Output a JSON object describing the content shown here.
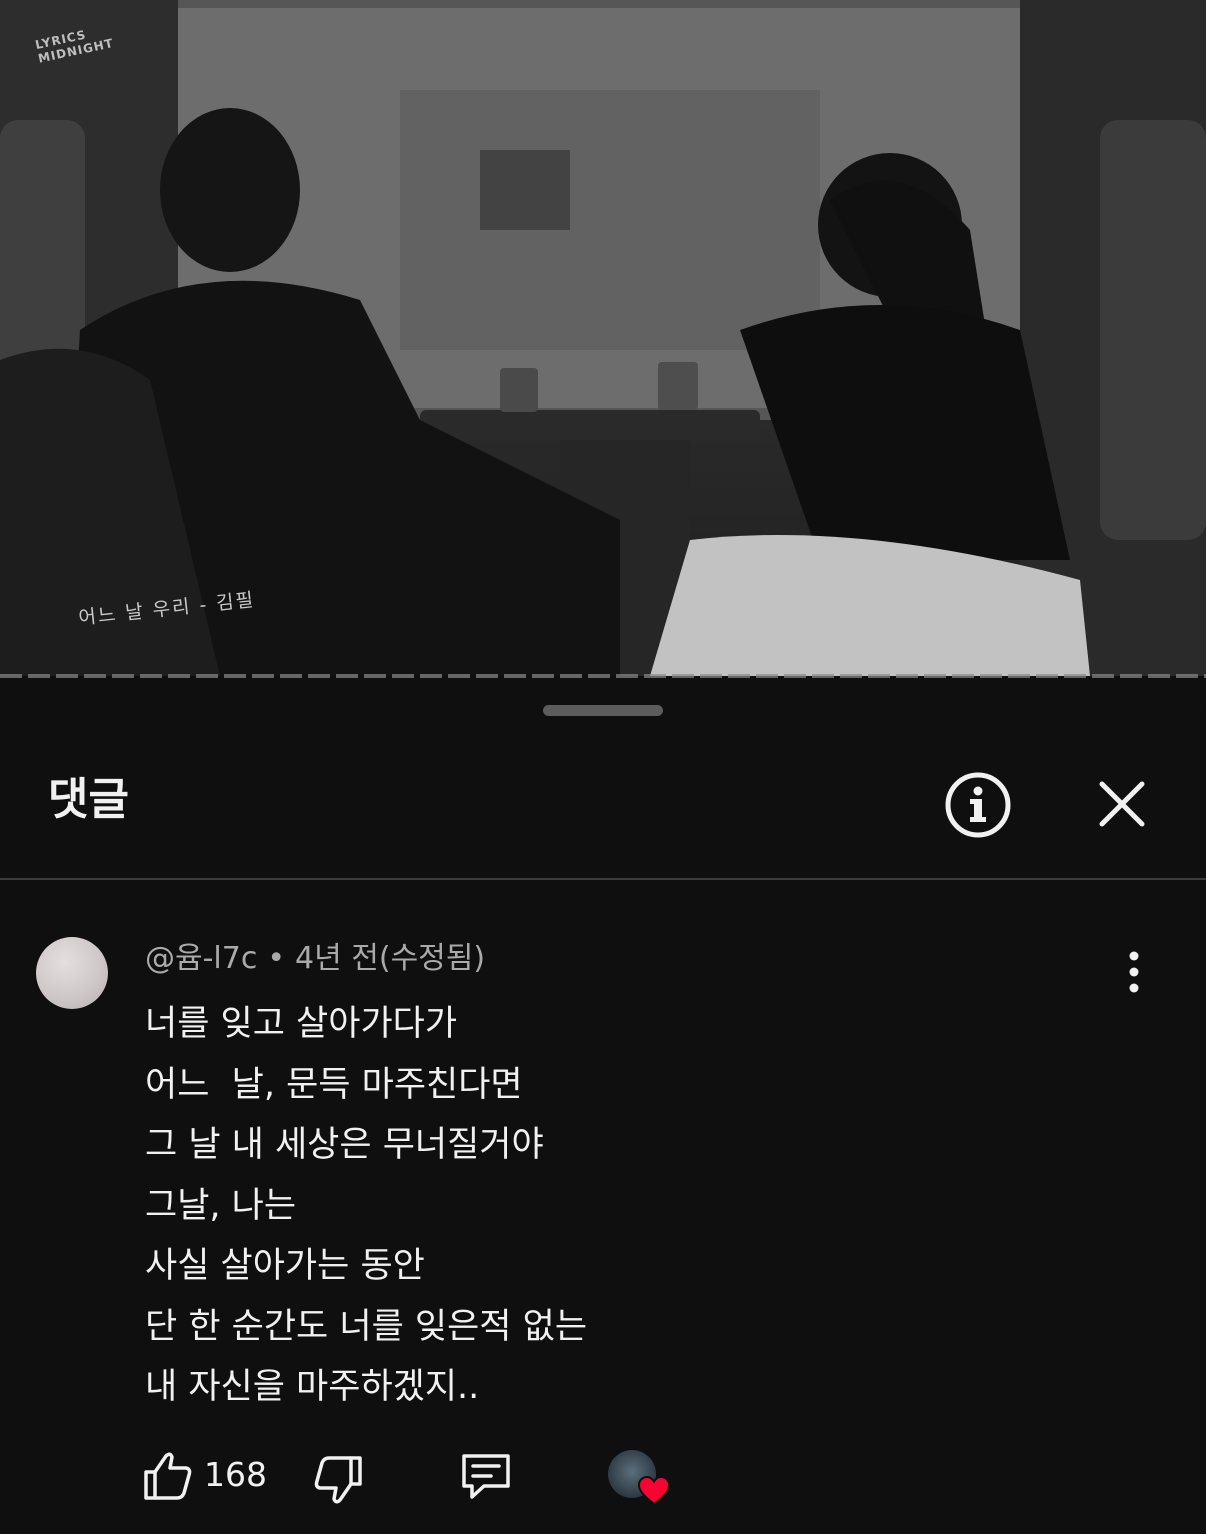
{
  "video": {
    "watermark_line1": "LYRICS",
    "watermark_line2": "MIDNIGHT",
    "caption": "어느 날 우리 - 김필"
  },
  "comments_panel": {
    "title": "댓글",
    "info_icon": "info-icon",
    "close_icon": "close-icon"
  },
  "comment": {
    "author": "@윰-l7c",
    "separator": "•",
    "time": "4년 전(수정됨)",
    "lines": [
      "너를 잊고 살아가다가",
      "어느  날, 문득 마주친다면",
      "그 날 내 세상은 무너질거야",
      "그날, 나는",
      "사실 살아가는 동안",
      "단 한 순간도 너를 잊은적 없는",
      "내 자신을 마주하겠지.."
    ],
    "like_count": "168",
    "icons": [
      "thumbs-up-icon",
      "thumbs-down-icon",
      "reply-icon",
      "more-vert-icon",
      "creator-heart-icon"
    ],
    "heart_color": "#ff0033"
  }
}
